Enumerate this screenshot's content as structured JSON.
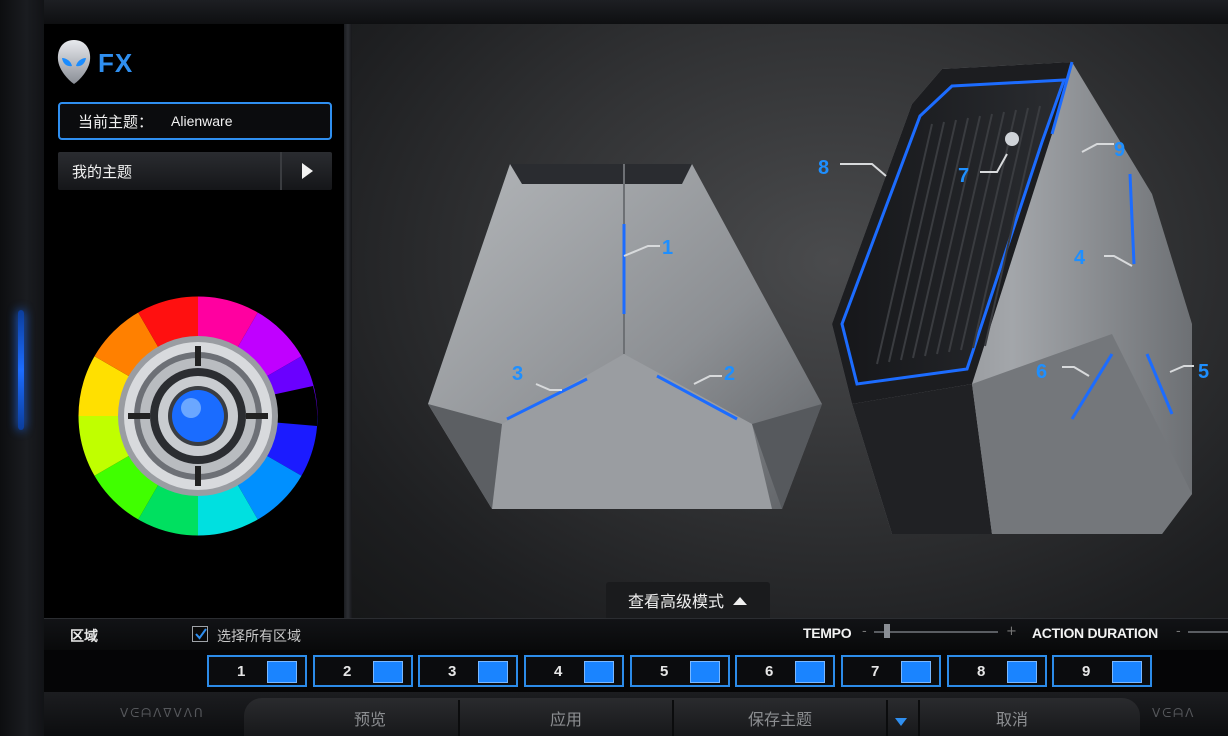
{
  "app": {
    "logo_text": "FX"
  },
  "theme": {
    "current_label": "当前主题：",
    "current_value": "Alienware",
    "my_themes_label": "我的主题"
  },
  "main": {
    "advanced_mode_label": "查看高级模式",
    "callouts": [
      "1",
      "2",
      "3",
      "4",
      "5",
      "6",
      "7",
      "8",
      "9"
    ]
  },
  "zones": {
    "title": "区域",
    "select_all_label": "选择所有区域",
    "select_all_checked": true,
    "tempo_label": "TEMPO",
    "action_duration_label": "ACTION DURATION",
    "buttons": [
      "1",
      "2",
      "3",
      "4",
      "5",
      "6",
      "7",
      "8",
      "9"
    ]
  },
  "actions": {
    "preview": "预览",
    "apply": "应用",
    "save_theme": "保存主题",
    "cancel": "取消"
  },
  "colors": {
    "accent": "#2f8ff0",
    "zone_swatch": "#1a84ff",
    "background": "#000000"
  },
  "icons": [
    "alien-head-icon",
    "play-arrow-icon",
    "color-wheel-icon",
    "chevron-up-icon",
    "check-icon",
    "dropdown-arrow-icon"
  ]
}
